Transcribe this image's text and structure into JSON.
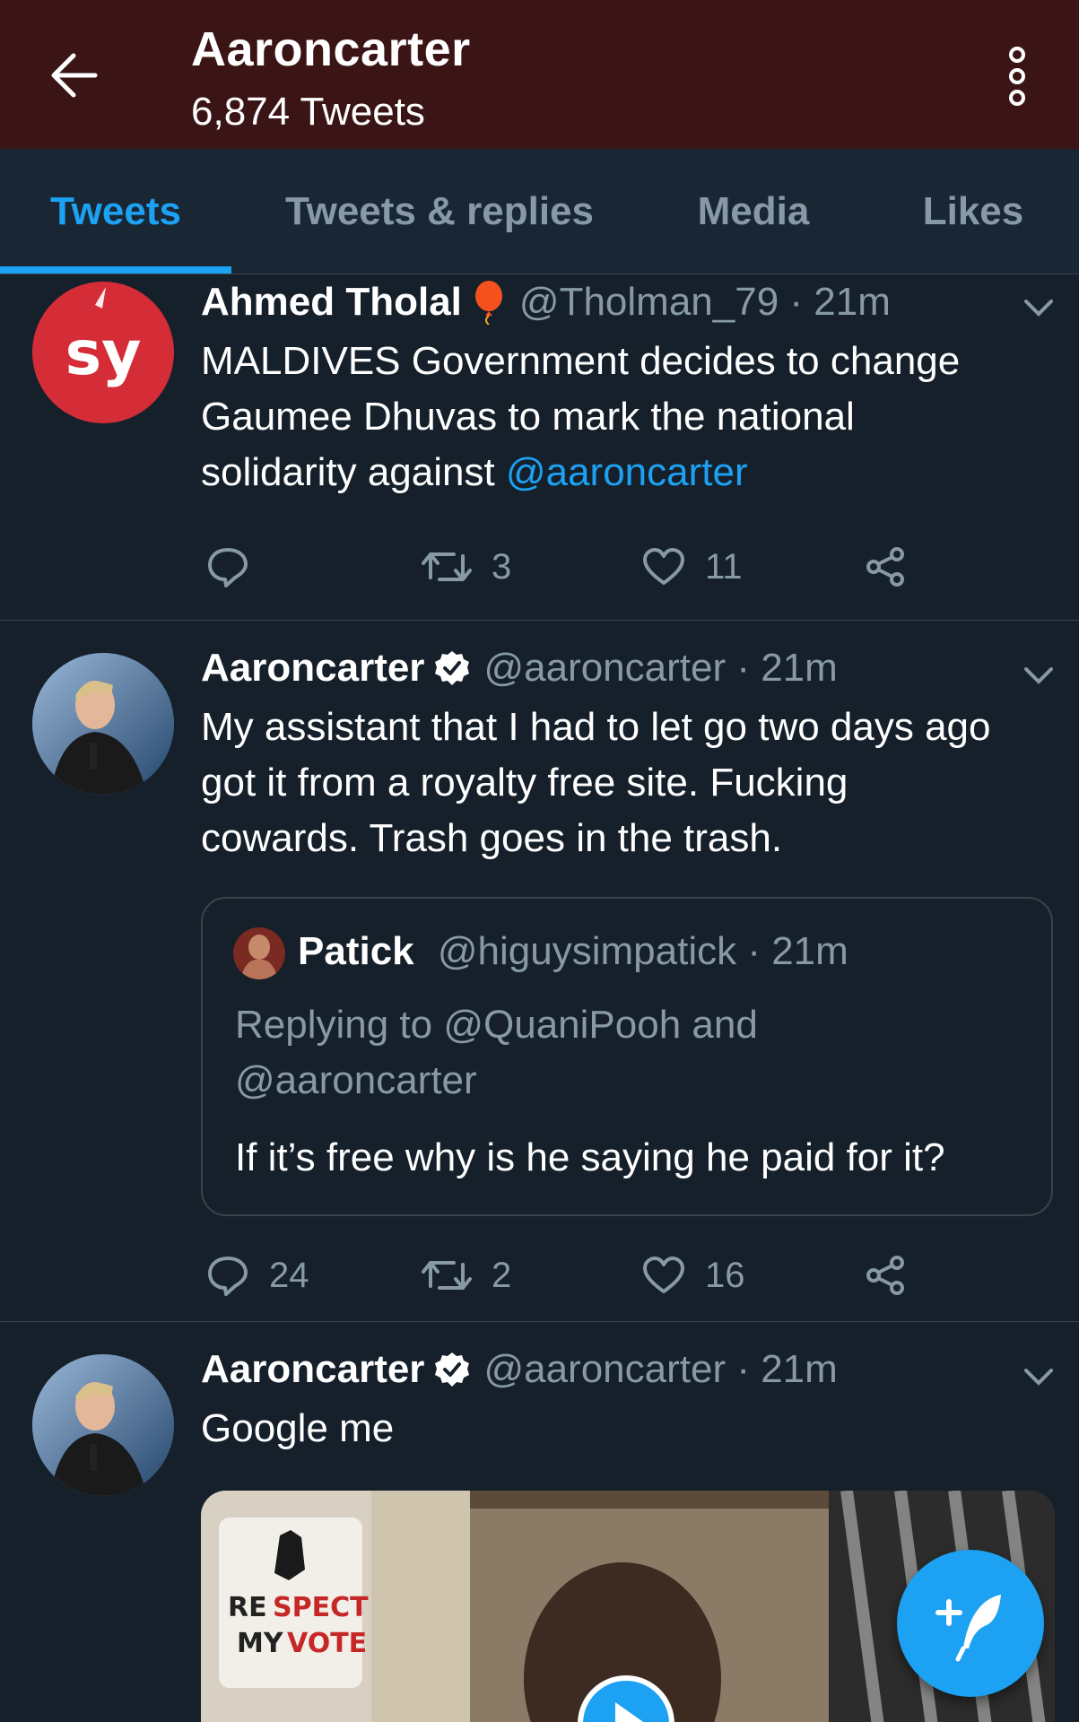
{
  "header": {
    "title": "Aaroncarter",
    "tweet_count": "6,874 Tweets"
  },
  "tabs": [
    {
      "label": "Tweets",
      "active": true
    },
    {
      "label": "Tweets & replies",
      "active": false
    },
    {
      "label": "Media",
      "active": false
    },
    {
      "label": "Likes",
      "active": false
    }
  ],
  "tweets": [
    {
      "name": "Ahmed Tholal",
      "handle_time": "@Tholman_79 · 21m",
      "text_lines": [
        "MALDIVES Government decides to change",
        "Gaumee Dhuvas to mark the national",
        "solidarity against "
      ],
      "mention": "@aaroncarter",
      "avatar_text": "sy",
      "replies": "",
      "retweets": "3",
      "likes": "11"
    },
    {
      "name": "Aaroncarter",
      "handle_time": "@aaroncarter · 21m",
      "text_lines": [
        "My assistant that I had to let go two days ago",
        "got it from a royalty free site. Fucking",
        "cowards. Trash goes in the trash."
      ],
      "quote": {
        "name": "Patick",
        "handle_time": "@higuysimpatick · 21m",
        "replying_lines": [
          "Replying to @QuaniPooh and",
          "@aaroncarter"
        ],
        "text": "If it’s free why is he saying he paid for it?"
      },
      "replies": "24",
      "retweets": "2",
      "likes": "16"
    },
    {
      "name": "Aaroncarter",
      "handle_time": "@aaroncarter · 21m",
      "text": "Google me"
    }
  ],
  "colors": {
    "header_bg": "#3b1416",
    "background": "#15202b",
    "accent": "#1da1f2",
    "muted": "#8899a6"
  }
}
